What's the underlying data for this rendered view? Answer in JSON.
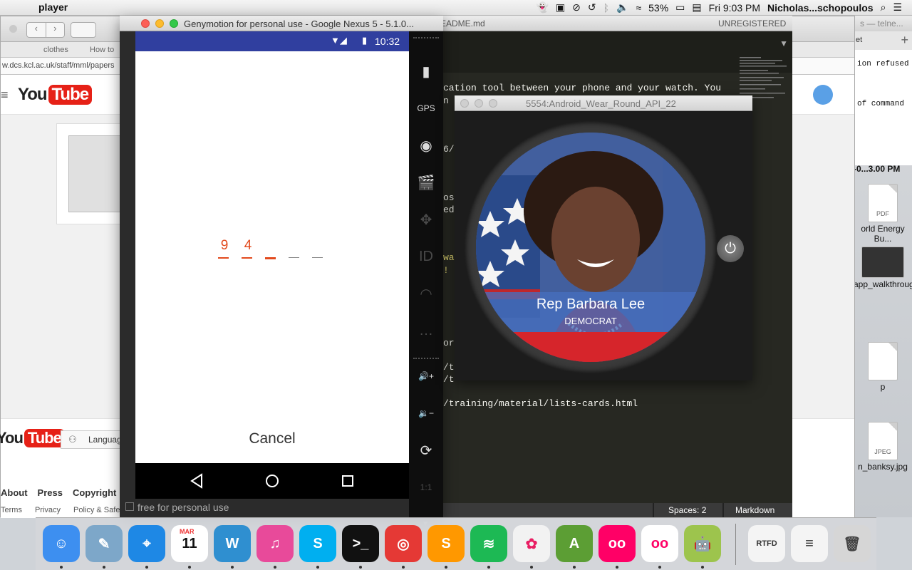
{
  "menubar": {
    "apple_glyph": "",
    "app_name": "player",
    "battery": "53%",
    "datetime": "Fri 9:03 PM",
    "user": "Nicholas...schopoulos"
  },
  "browser": {
    "bookmarks": [
      "clothes",
      "How to"
    ],
    "url": "w.dcs.kcl.ac.uk/staff/mml/papers",
    "logo_you": "You",
    "logo_tube": "Tube",
    "language_label": "Languag",
    "footer_links_row1": [
      "About",
      "Press",
      "Copyright"
    ],
    "footer_links_row2": [
      "Terms",
      "Privacy",
      "Policy & Safet"
    ]
  },
  "desktop_right": {
    "top_text_1": "s — telne...",
    "top_text_2": "et",
    "terminal_line1": "ion refused",
    "terminal_line2": "of command",
    "timestamp": "-0...3.00 PM",
    "file1_tag": "PDF",
    "file1_label": "orld Energy Bu...",
    "file2_label": "app_walkthrough",
    "file3_label": "p",
    "file4_tag": "JPEG",
    "file4_label": "n_banksy.jpg"
  },
  "editor": {
    "title_fragment": "EADME.md",
    "unregistered": "UNREGISTERED",
    "code_lines": [
      {
        "text": "cation tool between your phone and your watch. You",
        "color": "#f8f8f2"
      },
      {
        "text": "n",
        "color": "#f8f8f2"
      },
      {
        "text": "6/",
        "color": "#f8f8f2"
      },
      {
        "text": "os",
        "color": "#f8f8f2"
      },
      {
        "text": "ed",
        "color": "#f8f8f2"
      },
      {
        "text": "wa",
        "color": "#e6db74"
      },
      {
        "text": "! \"",
        "color": "#e6db74"
      },
      {
        "text": "or",
        "color": "#f8f8f2"
      },
      {
        "text": "/t",
        "color": "#f8f8f2"
      },
      {
        "text": "/t",
        "color": "#f8f8f2"
      },
      {
        "text": "/training/material/lists-cards.html",
        "color": "#f8f8f2"
      }
    ],
    "status_spaces": "Spaces: 2",
    "status_syntax": "Markdown"
  },
  "genymotion": {
    "window_title": "Genymotion for personal use - Google Nexus 5 - 5.1.0...",
    "watermark": "free for personal use",
    "status_time": "10:32",
    "pin_digits": [
      "9",
      "4",
      "",
      "",
      ""
    ],
    "active_index": 2,
    "cancel_label": "Cancel",
    "sidebar_icons": [
      {
        "name": "battery-icon",
        "glyph": "▮",
        "dim": false
      },
      {
        "name": "gps-icon",
        "glyph": "GPS",
        "dim": false
      },
      {
        "name": "webcam-icon",
        "glyph": "◉",
        "dim": false
      },
      {
        "name": "screencast-icon",
        "glyph": "🎬",
        "dim": true
      },
      {
        "name": "dpad-icon",
        "glyph": "✥",
        "dim": true
      },
      {
        "name": "identifiers-icon",
        "glyph": "ID",
        "dim": true
      },
      {
        "name": "network-icon",
        "glyph": "◠",
        "dim": true
      },
      {
        "name": "sms-icon",
        "glyph": "…",
        "dim": true
      },
      {
        "name": "volume-up-icon",
        "glyph": "🔊+",
        "dim": false
      },
      {
        "name": "volume-down-icon",
        "glyph": "🔉−",
        "dim": false
      },
      {
        "name": "rotate-icon",
        "glyph": "⟳",
        "dim": false
      },
      {
        "name": "pixel-perfect-icon",
        "glyph": "1:1",
        "dim": true
      }
    ]
  },
  "wear": {
    "window_title": "5554:Android_Wear_Round_API_22",
    "rep_name": "Rep Barbara Lee",
    "party": "DEMOCRAT"
  },
  "dock": {
    "apps": [
      {
        "name": "finder-icon",
        "label": "☺",
        "bg": "#3d8ff0"
      },
      {
        "name": "preview-icon",
        "label": "✎",
        "bg": "#7da7c9"
      },
      {
        "name": "safari-icon",
        "label": "⌖",
        "bg": "#1e88e5"
      },
      {
        "name": "calendar-icon",
        "label": "11",
        "bg": "#ffffff",
        "fg": "#111"
      },
      {
        "name": "word-icon",
        "label": "W",
        "bg": "#2f8fd0"
      },
      {
        "name": "itunes-icon",
        "label": "♫",
        "bg": "#e84a9a"
      },
      {
        "name": "skype-icon",
        "label": "S",
        "bg": "#00aff0"
      },
      {
        "name": "terminal-icon",
        "label": ">_",
        "bg": "#111111"
      },
      {
        "name": "chrome-icon",
        "label": "◎",
        "bg": "#e53935"
      },
      {
        "name": "sublime-icon",
        "label": "S",
        "bg": "#ff9800"
      },
      {
        "name": "spotify-icon",
        "label": "≋",
        "bg": "#1db954"
      },
      {
        "name": "photos-icon",
        "label": "✿",
        "bg": "#f2f2f2",
        "fg": "#e91e63"
      },
      {
        "name": "android-studio-icon",
        "label": "A",
        "bg": "#5c9e34"
      },
      {
        "name": "flickr-icon-1",
        "label": "oo",
        "bg": "#ff0066"
      },
      {
        "name": "flickr-icon-2",
        "label": "oo",
        "bg": "#ffffff",
        "fg": "#ff0066"
      },
      {
        "name": "android-icon",
        "label": "🤖",
        "bg": "#9dc44d"
      },
      {
        "name": "rtfd-file-icon",
        "label": "RTFD",
        "bg": "#f4f4f4",
        "fg": "#333"
      },
      {
        "name": "document-icon",
        "label": "≡",
        "bg": "#f4f4f4",
        "fg": "#333"
      },
      {
        "name": "trash-icon",
        "label": "🗑",
        "bg": "#d6d6d6",
        "fg": "#444"
      }
    ],
    "calendar_month": "MAR"
  }
}
